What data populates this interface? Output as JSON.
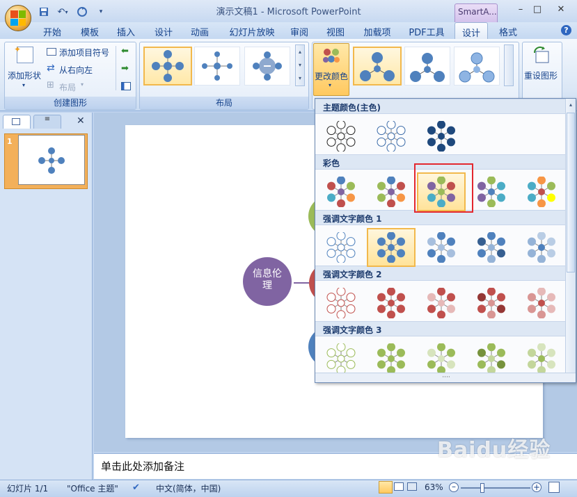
{
  "window": {
    "title": "演示文稿1 - Microsoft PowerPoint",
    "context_tab": "SmartA...",
    "controls": [
      "–",
      "□",
      "✕"
    ]
  },
  "tabs": [
    {
      "label": "开始"
    },
    {
      "label": "模板"
    },
    {
      "label": "插入"
    },
    {
      "label": "设计"
    },
    {
      "label": "动画"
    },
    {
      "label": "幻灯片放映"
    },
    {
      "label": "审阅"
    },
    {
      "label": "视图"
    },
    {
      "label": "加载项"
    },
    {
      "label": "PDF工具"
    },
    {
      "label": "设计",
      "active": true
    },
    {
      "label": "格式"
    }
  ],
  "ribbon": {
    "create_group": {
      "label": "创建图形",
      "add_shape": "添加形状",
      "add_bullet": "添加项目符号",
      "right_to_left": "从右向左",
      "layout": "布局"
    },
    "layout_group": {
      "label": "布局"
    },
    "change_colors": "更改颜色",
    "reset_graphic": "重设图形"
  },
  "slides_panel": {
    "slide_number": "1"
  },
  "slide": {
    "center_text": "信息伦理"
  },
  "colors_menu": {
    "sections": [
      {
        "title": "主题颜色(主色)"
      },
      {
        "title": "彩色"
      },
      {
        "title": "强调文字颜色 1"
      },
      {
        "title": "强调文字颜色 2"
      },
      {
        "title": "强调文字颜色 3"
      }
    ]
  },
  "notes": {
    "placeholder": "单击此处添加备注"
  },
  "status_bar": {
    "slide": "幻灯片 1/1",
    "theme": "\"Office 主题\"",
    "language": "中文(简体，中国)",
    "zoom": "63%"
  },
  "watermark": "Baidu经验",
  "colors": {
    "accent_purple": "#8064a2",
    "accent_green": "#9bbb59",
    "accent_red": "#c0504d",
    "accent_blue": "#4f81bd",
    "highlight": "#e3272e"
  }
}
